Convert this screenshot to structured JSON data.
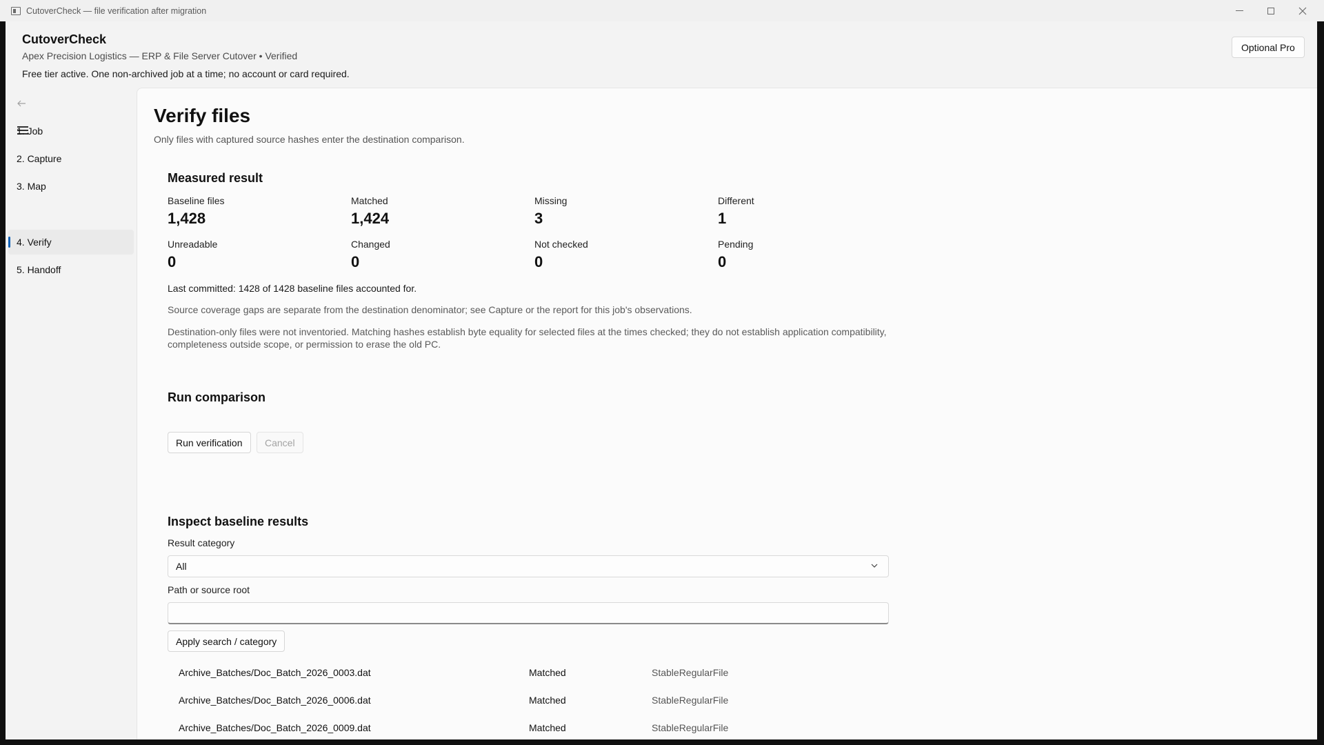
{
  "window": {
    "title": "CutoverCheck — file verification after migration"
  },
  "header": {
    "app_name": "CutoverCheck",
    "job_line": "Apex Precision Logistics — ERP & File Server Cutover  •  Verified",
    "tier_line": "Free tier active. One non-archived job at a time; no account or card required.",
    "pro_button": "Optional Pro"
  },
  "nav": {
    "items": [
      {
        "label": "1. Job",
        "selected": false
      },
      {
        "label": "2. Capture",
        "selected": false
      },
      {
        "label": "3. Map",
        "selected": false
      },
      {
        "label": "4. Verify",
        "selected": true
      },
      {
        "label": "5. Handoff",
        "selected": false
      }
    ]
  },
  "page": {
    "title": "Verify files",
    "subtitle": "Only files with captured source hashes enter the destination comparison."
  },
  "measured": {
    "heading": "Measured result",
    "metrics": [
      {
        "label": "Baseline files",
        "value": "1,428"
      },
      {
        "label": "Matched",
        "value": "1,424"
      },
      {
        "label": "Missing",
        "value": "3"
      },
      {
        "label": "Different",
        "value": "1"
      },
      {
        "label": "Unreadable",
        "value": "0"
      },
      {
        "label": "Changed",
        "value": "0"
      },
      {
        "label": "Not checked",
        "value": "0"
      },
      {
        "label": "Pending",
        "value": "0"
      }
    ],
    "last_committed": "Last committed: 1428 of 1428 baseline files accounted for.",
    "coverage_note": "Source coverage gaps are separate from the destination denominator; see Capture or the report for this job's observations.",
    "scope_note": "Destination-only files were not inventoried. Matching hashes establish byte equality for selected files at the times checked; they do not establish application compatibility, completeness outside scope, or permission to erase the old PC."
  },
  "run": {
    "heading": "Run comparison",
    "run_button": "Run verification",
    "cancel_button": "Cancel"
  },
  "inspect": {
    "heading": "Inspect baseline results",
    "category_label": "Result category",
    "category_value": "All",
    "path_label": "Path or source root",
    "path_value": "",
    "apply_button": "Apply search / category",
    "rows": [
      {
        "path": "Archive_Batches/Doc_Batch_2026_0003.dat",
        "status": "Matched",
        "kind": "StableRegularFile"
      },
      {
        "path": "Archive_Batches/Doc_Batch_2026_0006.dat",
        "status": "Matched",
        "kind": "StableRegularFile"
      },
      {
        "path": "Archive_Batches/Doc_Batch_2026_0009.dat",
        "status": "Matched",
        "kind": "StableRegularFile"
      }
    ]
  },
  "colors": {
    "accent": "#0f62b8",
    "window_bg": "#f3f3f3",
    "content_bg": "#fbfbfb"
  },
  "icons": {
    "back": "arrow-left-icon",
    "menu": "hamburger-menu-icon",
    "dropdown": "chevron-down-icon"
  }
}
